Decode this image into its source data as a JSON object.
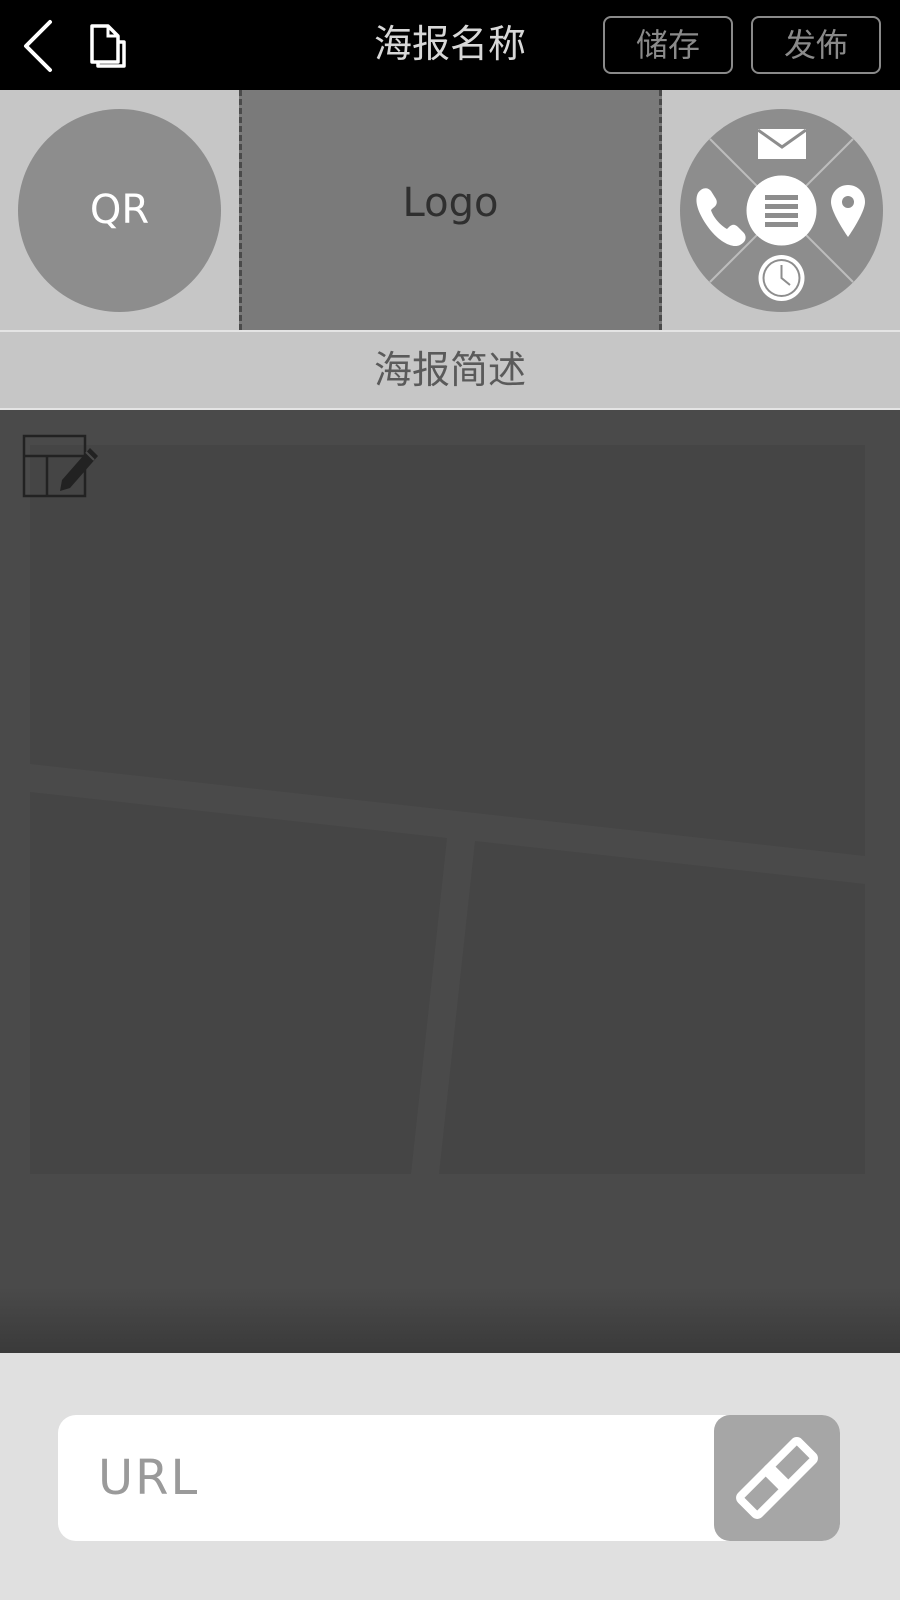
{
  "header": {
    "title": "海报名称",
    "save_label": "储存",
    "publish_label": "发佈",
    "back_icon": "chevron-left-icon",
    "doc_icon": "document-copy-icon"
  },
  "band": {
    "qr_label": "QR",
    "logo_label": "Logo",
    "contact_icons": [
      "mail-icon",
      "phone-icon",
      "location-pin-icon",
      "clock-icon",
      "menu-icon"
    ]
  },
  "description": {
    "label": "海报简述"
  },
  "image_area": {
    "edit_icon": "layout-edit-icon"
  },
  "url": {
    "placeholder": "URL",
    "link_icon": "link-icon"
  },
  "colors": {
    "topbar": "#000000",
    "band": "#c6c6c6",
    "image_bg": "#4a4a4a",
    "panel": "#454545",
    "bottom": "#e0e0e0",
    "link_button": "#a6a6a6"
  }
}
